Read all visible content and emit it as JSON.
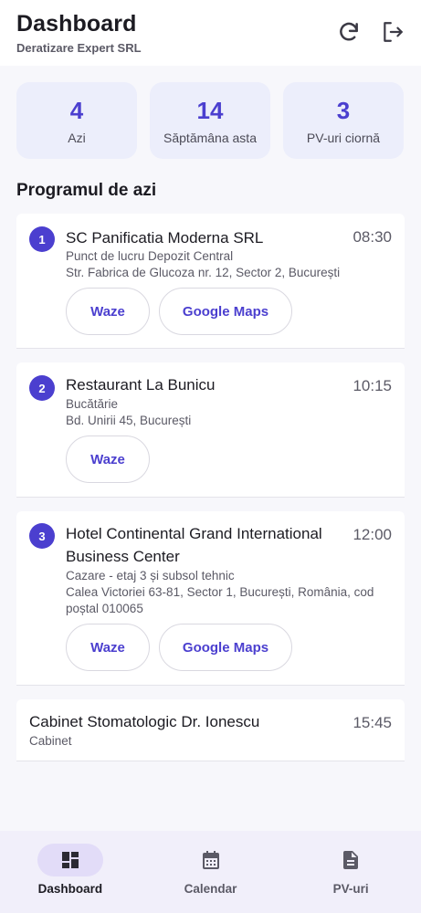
{
  "header": {
    "title": "Dashboard",
    "subtitle": "Deratizare Expert SRL",
    "refresh_icon": "refresh-icon",
    "logout_icon": "logout-icon"
  },
  "stats": [
    {
      "value": "4",
      "label": "Azi"
    },
    {
      "value": "14",
      "label": "Săptămâna asta"
    },
    {
      "value": "3",
      "label": "PV-uri ciornă"
    }
  ],
  "schedule": {
    "title": "Programul de azi",
    "items": [
      {
        "number": "1",
        "title": "SC Panificatia Moderna SRL",
        "time": "08:30",
        "location": "Punct de lucru Depozit Central",
        "address": "Str. Fabrica de Glucoza nr. 12, Sector 2, București",
        "waze_label": "Waze",
        "maps_label": "Google Maps"
      },
      {
        "number": "2",
        "title": "Restaurant La Bunicu",
        "time": "10:15",
        "location": "Bucătărie",
        "address": "Bd. Unirii 45, București",
        "waze_label": "Waze"
      },
      {
        "number": "3",
        "title_line1": "Hotel Continental Grand International",
        "title_line2": "Business Center",
        "time": "12:00",
        "location": "Cazare - etaj 3 și subsol tehnic",
        "address_line1": "Calea Victoriei 63-81, Sector 1, București, România, cod",
        "address_line2": "poștal 010065",
        "waze_label": "Waze",
        "maps_label": "Google Maps"
      },
      {
        "title": "Cabinet Stomatologic Dr. Ionescu",
        "time": "15:45",
        "location": "Cabinet"
      }
    ]
  },
  "nav": {
    "items": [
      {
        "label": "Dashboard",
        "icon": "dashboard-icon",
        "active": true
      },
      {
        "label": "Calendar",
        "icon": "calendar-icon",
        "active": false
      },
      {
        "label": "PV-uri",
        "icon": "document-icon",
        "active": false
      }
    ]
  },
  "colors": {
    "accent": "#4b3fcf",
    "stat_bg": "#eceefb",
    "nav_bg": "#f1effa",
    "nav_active_pill": "#e2dcf8"
  }
}
